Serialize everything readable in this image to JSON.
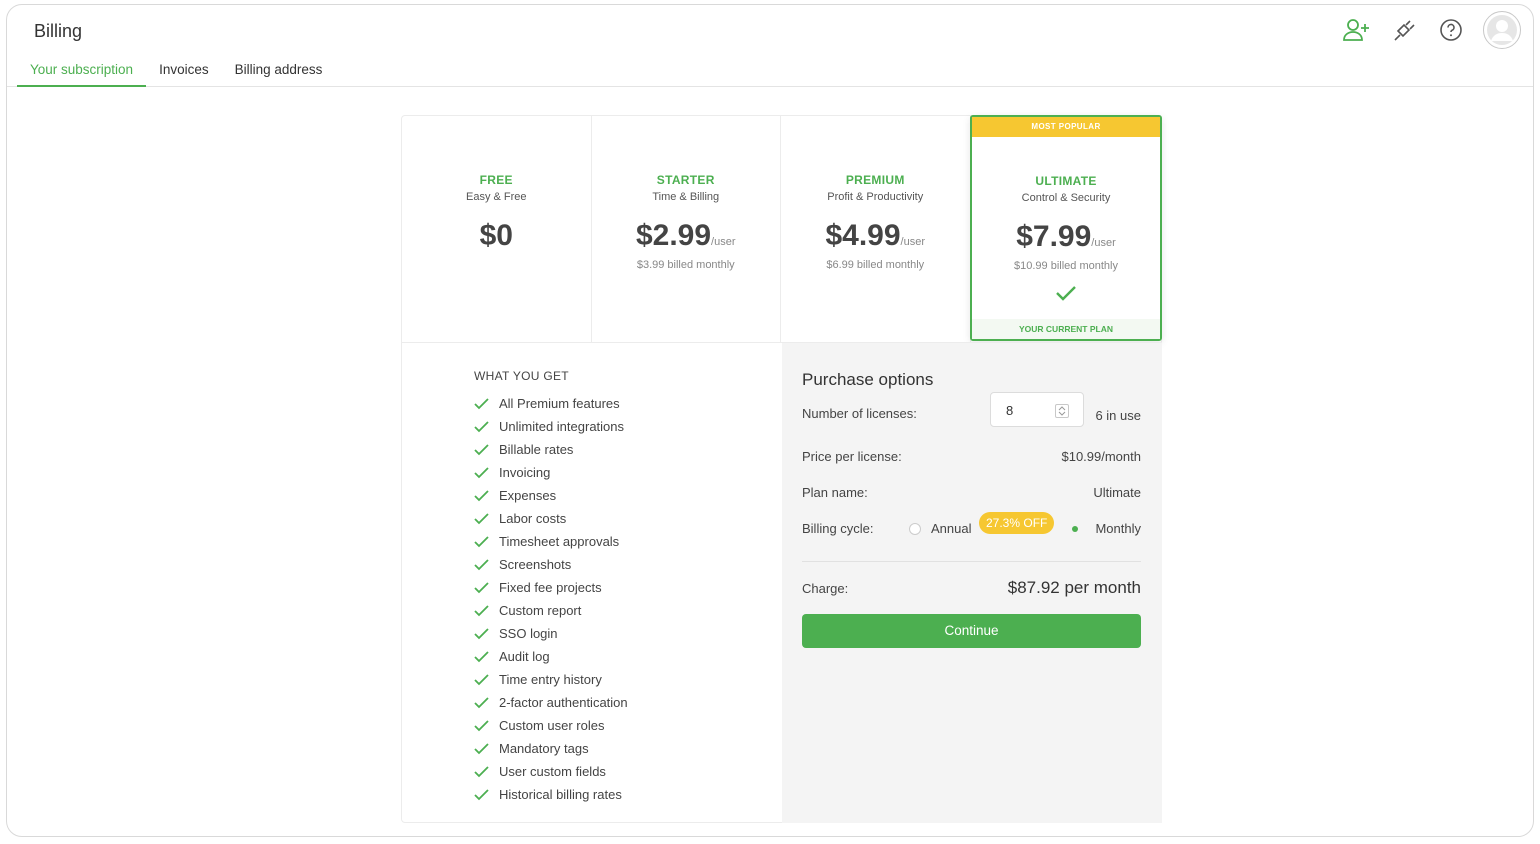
{
  "header": {
    "title": "Billing",
    "tabs": [
      {
        "label": "Your subscription",
        "active": true
      },
      {
        "label": "Invoices",
        "active": false
      },
      {
        "label": "Billing address",
        "active": false
      }
    ],
    "icons": [
      "add-user-icon",
      "plug-icon",
      "help-icon",
      "avatar"
    ]
  },
  "plans": [
    {
      "name": "FREE",
      "subtitle": "Easy & Free",
      "price": "$0",
      "unit": "",
      "billed": ""
    },
    {
      "name": "STARTER",
      "subtitle": "Time & Billing",
      "price": "$2.99",
      "unit": "/user",
      "billed": "$3.99 billed monthly"
    },
    {
      "name": "PREMIUM",
      "subtitle": "Profit & Productivity",
      "price": "$4.99",
      "unit": "/user",
      "billed": "$6.99 billed monthly"
    },
    {
      "name": "ULTIMATE",
      "subtitle": "Control & Security",
      "price": "$7.99",
      "unit": "/user",
      "billed": "$10.99 billed monthly",
      "badge": "MOST POPULAR",
      "current_label": "YOUR CURRENT PLAN"
    }
  ],
  "features": {
    "title": "WHAT YOU GET",
    "items": [
      "All Premium features",
      "Unlimited integrations",
      "Billable rates",
      "Invoicing",
      "Expenses",
      "Labor costs",
      "Timesheet approvals",
      "Screenshots",
      "Fixed fee projects",
      "Custom report",
      "SSO login",
      "Audit log",
      "Time entry history",
      "2-factor authentication",
      "Custom user roles",
      "Mandatory tags",
      "User custom fields",
      "Historical billing rates"
    ]
  },
  "purchase": {
    "title": "Purchase options",
    "licenses_label": "Number of licenses:",
    "licenses_value": "8",
    "in_use": "6 in use",
    "price_label": "Price per license:",
    "price_value": "$10.99/month",
    "plan_label": "Plan name:",
    "plan_value": "Ultimate",
    "cycle_label": "Billing cycle:",
    "annual_label": "Annual",
    "annual_discount": "27.3% OFF",
    "monthly_label": "Monthly",
    "selected_cycle": "Monthly",
    "charge_label": "Charge:",
    "charge_value": "$87.92 per month",
    "continue_label": "Continue"
  },
  "colors": {
    "accent": "#4caf50",
    "badge": "#f6c731"
  }
}
